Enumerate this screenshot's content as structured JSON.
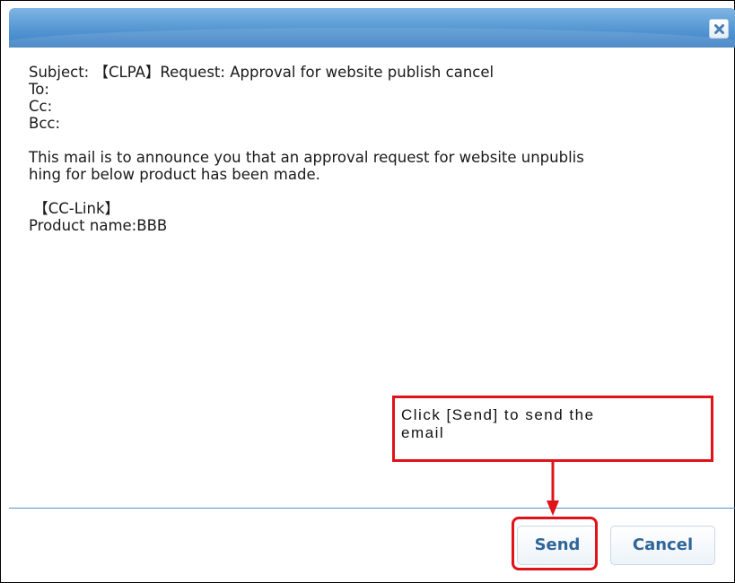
{
  "dialog": {
    "close_icon": "close-icon"
  },
  "email": {
    "subject": "Subject: 【CLPA】Request: Approval for website publish cancel",
    "to": "To:",
    "cc": "Cc:",
    "bcc": "Bcc:",
    "body_line1": "This mail is to announce you that an approval request for website unpublis",
    "body_line2": "hing for below product has been made.",
    "product_group": " 【CC-Link】",
    "product_name": "Product name:BBB"
  },
  "footer": {
    "send_label": "Send",
    "cancel_label": "Cancel"
  },
  "annotation": {
    "callout_line1": "Click [Send] to send the",
    "callout_line2": "email",
    "color": "#e0121a"
  },
  "colors": {
    "titlebar": "#5e9fd7",
    "button_text": "#2f6699",
    "divider": "#5a8fcf"
  }
}
